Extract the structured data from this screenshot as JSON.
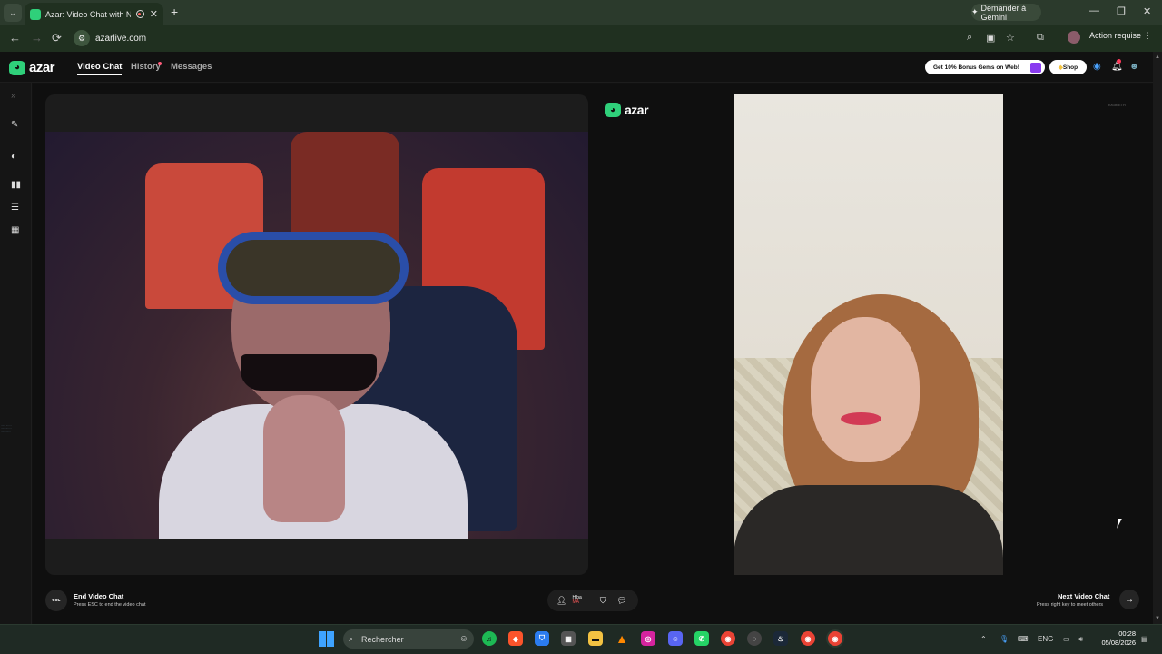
{
  "browser": {
    "tab_title": "Azar: Video Chat with New",
    "tab_close": "✕",
    "new_tab": "+",
    "gemini_label": "Demander à Gemini",
    "url": "azarlive.com",
    "action_required": "Action requise"
  },
  "header": {
    "logo": "azar",
    "nav": [
      "Video Chat",
      "History",
      "Messages"
    ],
    "bonus": "Get 10% Bonus Gems on Web!",
    "shop": "Shop"
  },
  "stage": {
    "brand": "azar",
    "partner_tag": "90t3ixrETR"
  },
  "controls": {
    "esc_key": "esc",
    "end_title": "End Video Chat",
    "end_sub": "Press ESC to end the video chat",
    "partner_name": "Hiba",
    "partner_country": "MA",
    "next_title": "Next Video Chat",
    "next_sub": "Press right key to meet others"
  },
  "taskbar": {
    "search_placeholder": "Rechercher",
    "lang": "ENG",
    "time": "00:28",
    "date": "05/08/2026"
  },
  "colors": {
    "azar_green": "#2fd07a",
    "chrome_green": "#203020",
    "notification_red": "#ff3b5b"
  }
}
